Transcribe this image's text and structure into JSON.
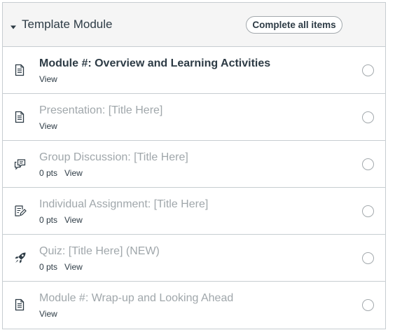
{
  "module": {
    "title": "Template Module",
    "complete_all_label": "Complete all items",
    "items": [
      {
        "title": "Module #: Overview and Learning Activities",
        "points": "",
        "view": "View",
        "icon": "page-icon",
        "emphasized": true
      },
      {
        "title": "Presentation: [Title Here]",
        "points": "",
        "view": "View",
        "icon": "page-icon",
        "emphasized": false
      },
      {
        "title": "Group Discussion: [Title Here]",
        "points": "0 pts",
        "view": "View",
        "icon": "discussion-icon",
        "emphasized": false
      },
      {
        "title": "Individual Assignment: [Title Here]",
        "points": "0 pts",
        "view": "View",
        "icon": "assignment-icon",
        "emphasized": false
      },
      {
        "title": "Quiz: [Title Here] (NEW)",
        "points": "0 pts",
        "view": "View",
        "icon": "quiz-rocket-icon",
        "emphasized": false
      },
      {
        "title": "Module #: Wrap-up and Looking Ahead",
        "points": "",
        "view": "View",
        "icon": "page-icon",
        "emphasized": false
      }
    ]
  },
  "colors": {
    "header_bg": "#f5f5f5",
    "border": "#c7cdd1",
    "text_dark": "#2d3b45",
    "text_muted": "#a0a7ab"
  }
}
